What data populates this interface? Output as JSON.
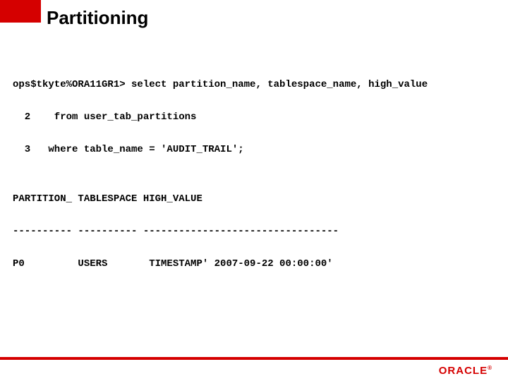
{
  "title": "Partitioning",
  "sql": {
    "l1": "ops$tkyte%ORA11GR1> select partition_name, tablespace_name, high_value",
    "l2": "  2    from user_tab_partitions",
    "l3": "  3   where table_name = 'AUDIT_TRAIL';",
    "blank1": "",
    "h1": "PARTITION_ TABLESPACE HIGH_VALUE",
    "h2": "---------- ---------- ---------------------------------",
    "r1": "P0         USERS       TIMESTAMP' 2007-09-22 00:00:00'"
  },
  "brand": "ORACLE",
  "reg": "®"
}
